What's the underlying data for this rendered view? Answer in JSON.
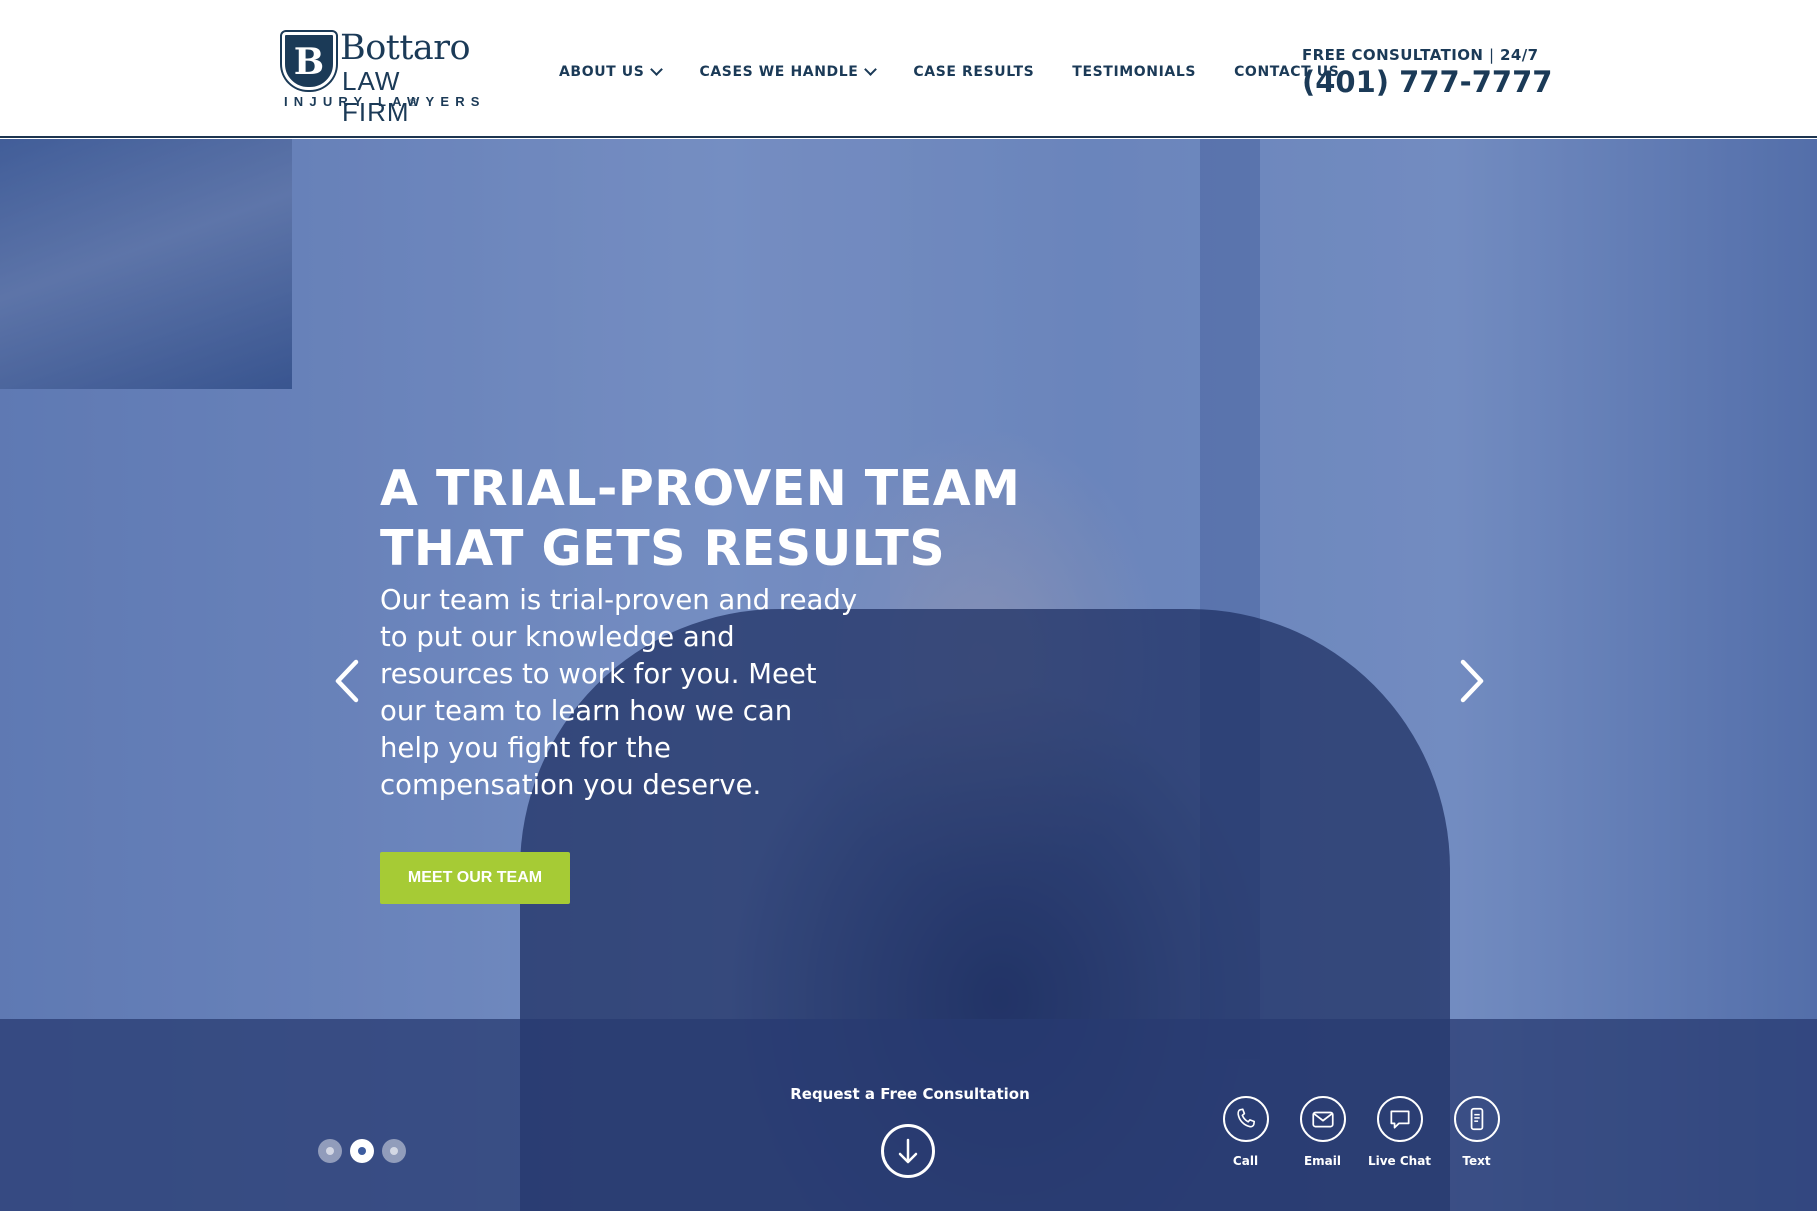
{
  "brand": {
    "seal_letter": "B",
    "name": "Bottaro",
    "firm": "LAW FIRM",
    "registered": "®",
    "tagline": "INJURY LAWYERS"
  },
  "nav": {
    "items": [
      {
        "label": "ABOUT US",
        "has_dropdown": true
      },
      {
        "label": "CASES WE HANDLE",
        "has_dropdown": true
      },
      {
        "label": "CASE RESULTS",
        "has_dropdown": false
      },
      {
        "label": "TESTIMONIALS",
        "has_dropdown": false
      },
      {
        "label": "CONTACT US",
        "has_dropdown": false
      }
    ]
  },
  "consultation": {
    "label": "FREE CONSULTATION",
    "separator": "|",
    "availability": "24/7",
    "phone": "(401) 777-7777"
  },
  "hero": {
    "title_line1": "A TRIAL-PROVEN TEAM",
    "title_line2": "THAT GETS RESULTS",
    "body": "Our team is trial-proven and ready to put our knowledge and resources to work for you. Meet our team to learn how we can help you fight for the compensation you deserve.",
    "button_label": "MEET OUR TEAM",
    "slides_total": 3,
    "active_slide": 2
  },
  "cta": {
    "request_label": "Request a Free Consultation"
  },
  "contact_options": [
    {
      "label": "Call",
      "icon": "phone-icon"
    },
    {
      "label": "Email",
      "icon": "envelope-icon"
    },
    {
      "label": "Live Chat",
      "icon": "chat-bubble-icon"
    },
    {
      "label": "Text",
      "icon": "mobile-text-icon"
    }
  ],
  "colors": {
    "brand_navy": "#1b3a57",
    "accent_green": "#a6cb35",
    "hero_overlay": "#5a7fc0"
  }
}
